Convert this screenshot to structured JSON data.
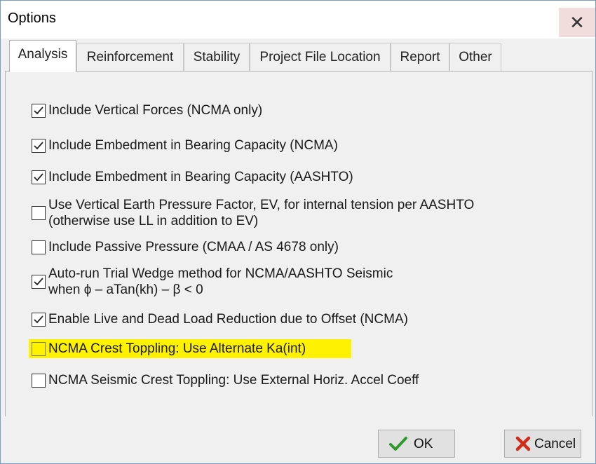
{
  "window": {
    "title": "Options",
    "close_glyph": "✕"
  },
  "tabs": [
    {
      "label": "Analysis",
      "active": true
    },
    {
      "label": "Reinforcement"
    },
    {
      "label": "Stability"
    },
    {
      "label": "Project File Location"
    },
    {
      "label": "Report"
    },
    {
      "label": "Other"
    }
  ],
  "options": [
    {
      "label": "Include Vertical Forces (NCMA only)",
      "checked": true
    },
    {
      "label": "Include Embedment in Bearing Capacity (NCMA)",
      "checked": true
    },
    {
      "label": "Include Embedment in Bearing Capacity (AASHTO)",
      "checked": true
    },
    {
      "label": "Use Vertical Earth Pressure Factor, EV, for internal tension per AASHTO",
      "label2": "(otherwise use LL in addition to EV)",
      "checked": false
    },
    {
      "label": "Include Passive Pressure (CMAA / AS 4678 only)",
      "checked": false
    },
    {
      "label": "Auto-run Trial Wedge method for NCMA/AASHTO Seismic",
      "label2": "when  ϕ – aTan(kh) – β < 0",
      "checked": true
    },
    {
      "label": "Enable Live and Dead Load Reduction due to Offset (NCMA)",
      "checked": true
    },
    {
      "label": "NCMA Crest Toppling: Use Alternate Ka(int)",
      "checked": false,
      "highlighted": true
    },
    {
      "label": "NCMA Seismic Crest Toppling: Use External Horiz. Accel Coeff",
      "checked": false
    }
  ],
  "buttons": {
    "ok": "OK",
    "cancel": "Cancel"
  },
  "colors": {
    "highlight": "#fff200",
    "ok_check": "#2e9a2e",
    "cancel_x": "#d42a1a",
    "window_border": "#7a9cc8"
  },
  "icons": {
    "ok": "check-icon",
    "cancel": "x-icon",
    "close": "close-icon"
  }
}
